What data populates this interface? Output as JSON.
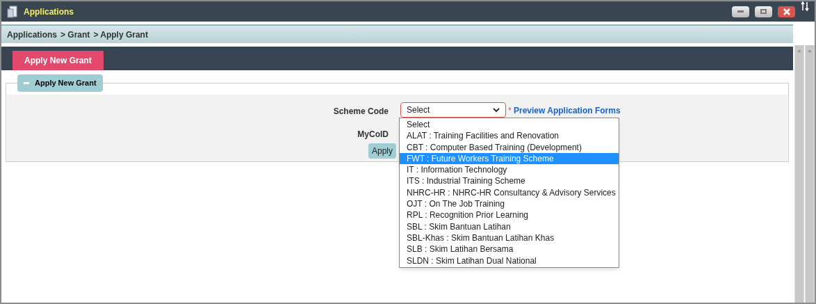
{
  "window": {
    "title": "Applications"
  },
  "breadcrumb": [
    "Applications",
    "> Grant",
    "> Apply Grant"
  ],
  "tabs": [
    {
      "label": "Apply New Grant",
      "selected": true
    }
  ],
  "section": {
    "title": "Apply New Grant",
    "expanded": true
  },
  "form": {
    "scheme_code_label": "Scheme Code",
    "scheme_code_value": "Select",
    "required_mark": "*",
    "preview_link": "Preview Application Forms",
    "mycoid_label": "MyCoID",
    "apply_button": "Apply"
  },
  "dropdown": {
    "open": true,
    "options": [
      {
        "label": "Select",
        "selected": false
      },
      {
        "label": "ALAT : Training Facilities and Renovation",
        "selected": false
      },
      {
        "label": "CBT : Computer Based Training (Development)",
        "selected": false
      },
      {
        "label": "FWT : Future Workers Training Scheme",
        "selected": true
      },
      {
        "label": "IT : Information Technology",
        "selected": false
      },
      {
        "label": "ITS : Industrial Training Scheme",
        "selected": false
      },
      {
        "label": "NHRC-HR : NHRC-HR Consultancy & Advisory Services",
        "selected": false
      },
      {
        "label": "OJT : On The Job Training",
        "selected": false
      },
      {
        "label": "RPL : Recognition Prior Learning",
        "selected": false
      },
      {
        "label": "SBL : Skim Bantuan Latihan",
        "selected": false
      },
      {
        "label": "SBL-Khas : Skim Bantuan Latihan Khas",
        "selected": false
      },
      {
        "label": "SLB : Skim Latihan Bersama",
        "selected": false
      },
      {
        "label": "SLDN : Skim Latihan Dual National",
        "selected": false
      }
    ]
  }
}
